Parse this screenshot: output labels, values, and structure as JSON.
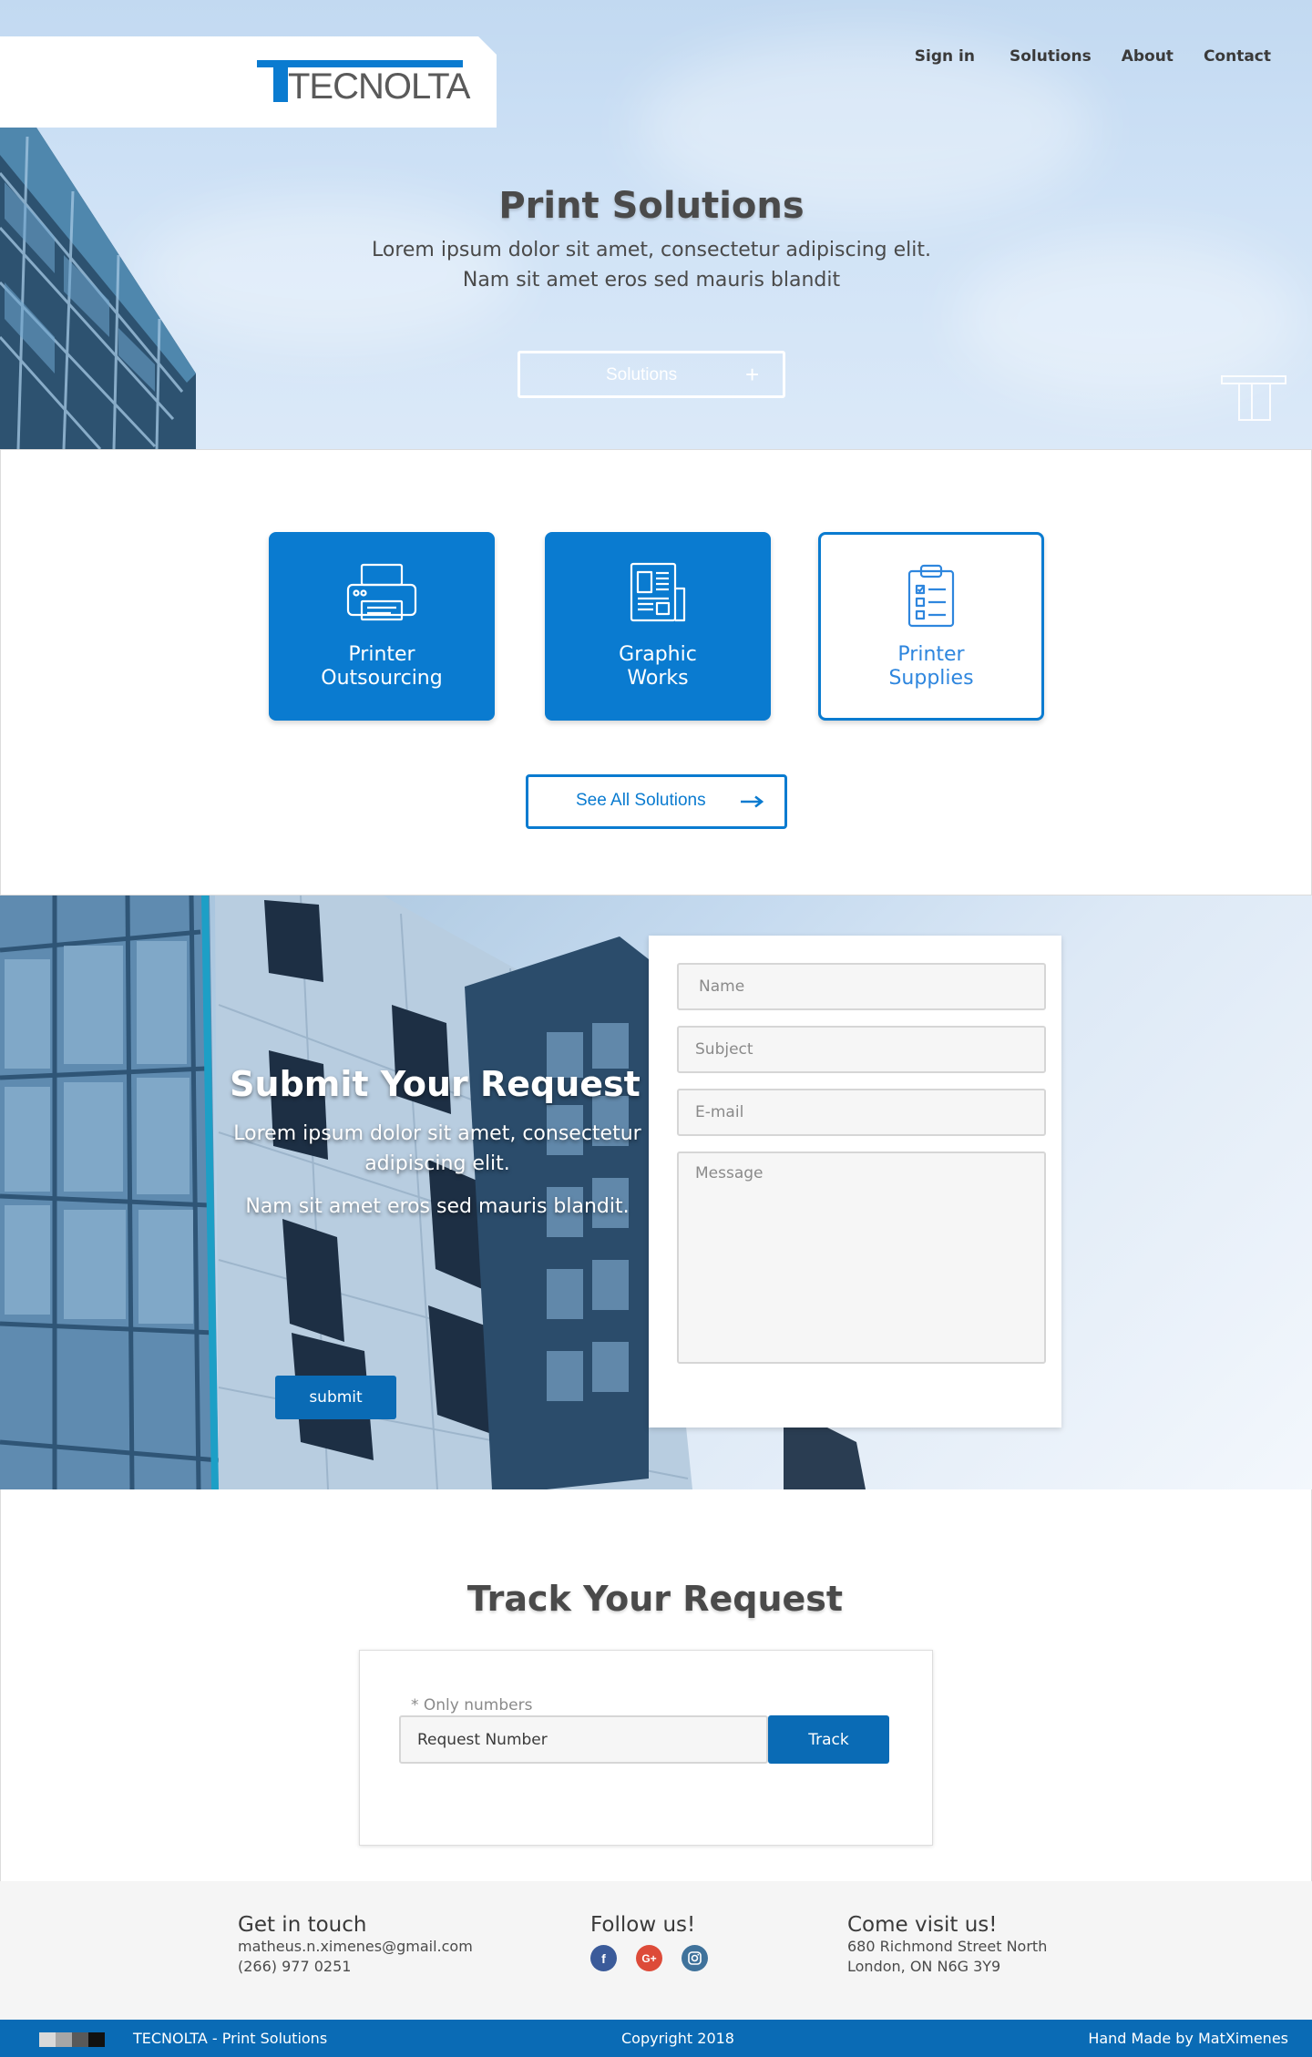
{
  "brand": {
    "name": "TECNOLTA",
    "accent": "#0a7bd0",
    "dark_accent": "#0a6bb5"
  },
  "nav": {
    "items": [
      "Sign in",
      "Solutions",
      "About",
      "Contact"
    ]
  },
  "hero": {
    "title": "Print Solutions",
    "subtitle_line1": "Lorem ipsum dolor sit amet, consectetur adipiscing elit.",
    "subtitle_line2": "Nam sit amet eros sed mauris blandit",
    "button_label": "Solutions",
    "button_icon": "plus-icon"
  },
  "solutions": {
    "cards": [
      {
        "line1": "Printer",
        "line2": "Outsourcing",
        "icon": "printer-icon"
      },
      {
        "line1": "Graphic",
        "line2": "Works",
        "icon": "newspaper-icon"
      },
      {
        "line1": "Printer",
        "line2": "Supplies",
        "icon": "clipboard-checklist-icon"
      }
    ],
    "see_all_label": "See All Solutions",
    "see_all_icon": "arrow-right-icon"
  },
  "request": {
    "title": "Submit Your Request",
    "para1": "Lorem ipsum dolor sit amet, consectetur adipiscing elit.",
    "para2": "Nam sit amet eros sed mauris blandit.",
    "form": {
      "name_placeholder": "Name",
      "subject_placeholder": "Subject",
      "email_placeholder": "E-mail",
      "message_placeholder": "Message",
      "submit_label": "submit"
    }
  },
  "track": {
    "title": "Track Your Request",
    "hint": "* Only numbers",
    "input_placeholder": "Request Number",
    "button_label": "Track"
  },
  "footer": {
    "contact": {
      "heading": "Get in touch",
      "email": "matheus.n.ximenes@gmail.com",
      "phone": "(266) 977 0251"
    },
    "follow": {
      "heading": "Follow us!",
      "networks": [
        "facebook-icon",
        "google-plus-icon",
        "instagram-icon"
      ]
    },
    "visit": {
      "heading": "Come visit us!",
      "address1": "680 Richmond Street North",
      "address2": "London, ON N6G 3Y9"
    }
  },
  "bottom_bar": {
    "site_name": "TECNOLTA - Print Solutions",
    "copyright": "Copyright 2018",
    "credit": "Hand Made by MatXimenes",
    "swatch_colors": [
      "#d9d9d9",
      "#a6a6a6",
      "#595959",
      "#111111"
    ]
  }
}
